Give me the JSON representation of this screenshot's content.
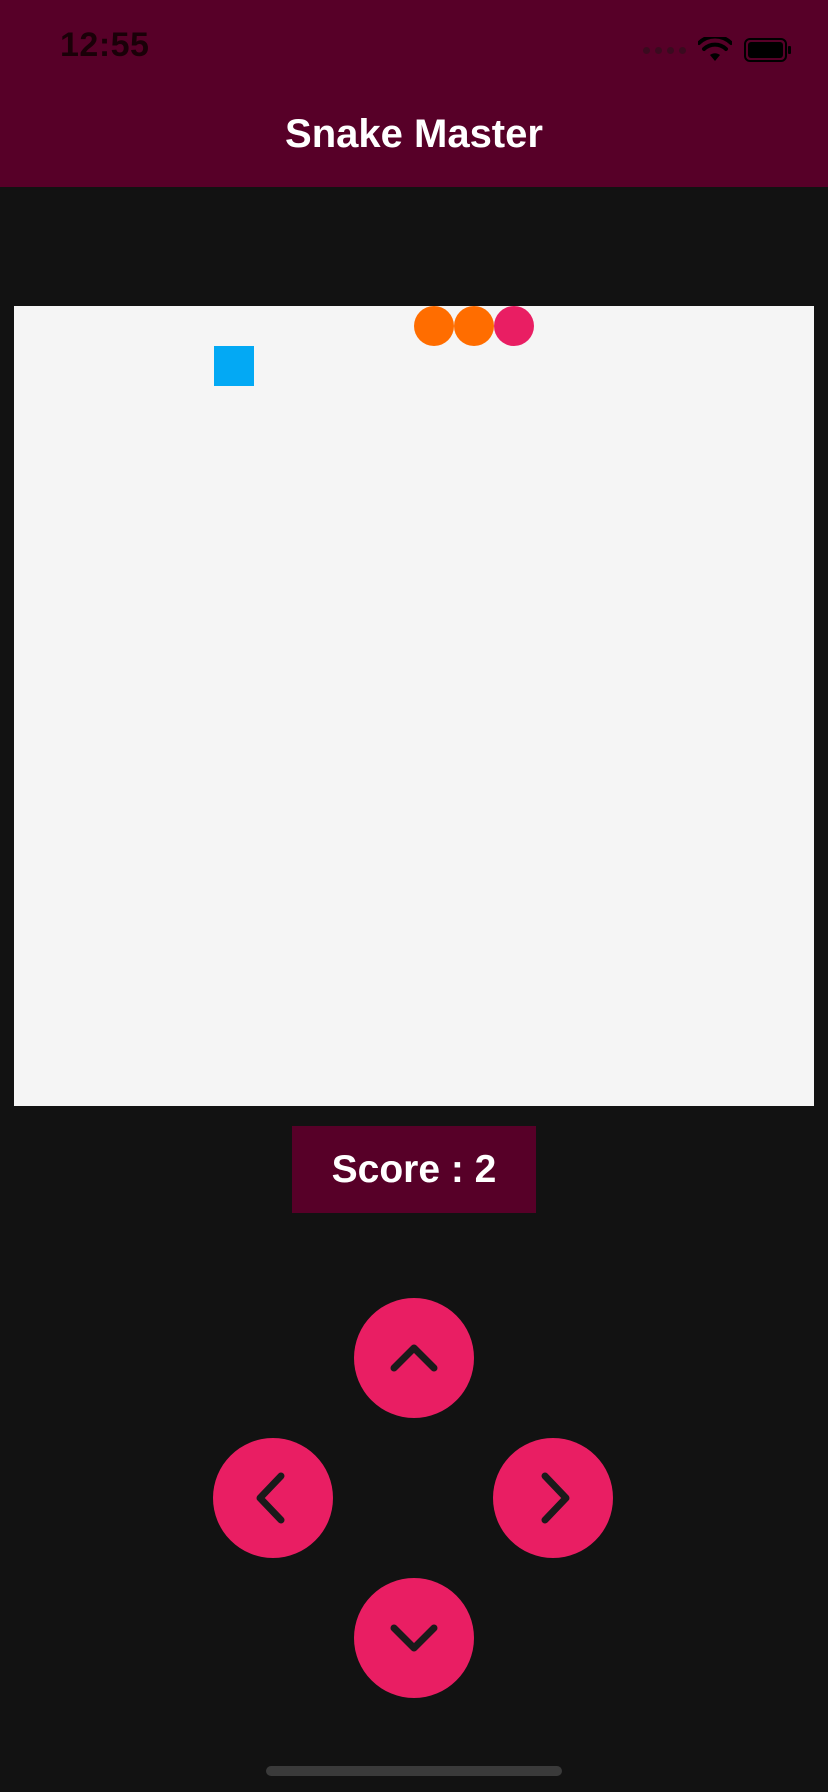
{
  "status_bar": {
    "time": "12:55",
    "wifi_icon": "wifi-icon",
    "battery_icon": "battery-icon",
    "signal_icon": "signal-icon"
  },
  "header": {
    "title": "Snake Master"
  },
  "game": {
    "board_color": "#f5f5f5",
    "food_color": "#03a9f4",
    "snake_body_color": "#ff6d00",
    "snake_head_color": "#e91e63",
    "grid_size": 20,
    "food": {
      "col": 5,
      "row": 1
    },
    "snake": [
      {
        "col": 10,
        "row": 0,
        "part": "body"
      },
      {
        "col": 11,
        "row": 0,
        "part": "body"
      },
      {
        "col": 12,
        "row": 0,
        "part": "head"
      }
    ]
  },
  "score": {
    "text": "Score : 2",
    "value": 2
  },
  "controls": {
    "up_icon": "chevron-up-icon",
    "left_icon": "chevron-left-icon",
    "right_icon": "chevron-right-icon",
    "down_icon": "chevron-down-icon",
    "button_color": "#e91e63"
  },
  "colors": {
    "header_bg": "#570028",
    "app_bg": "#121212"
  }
}
